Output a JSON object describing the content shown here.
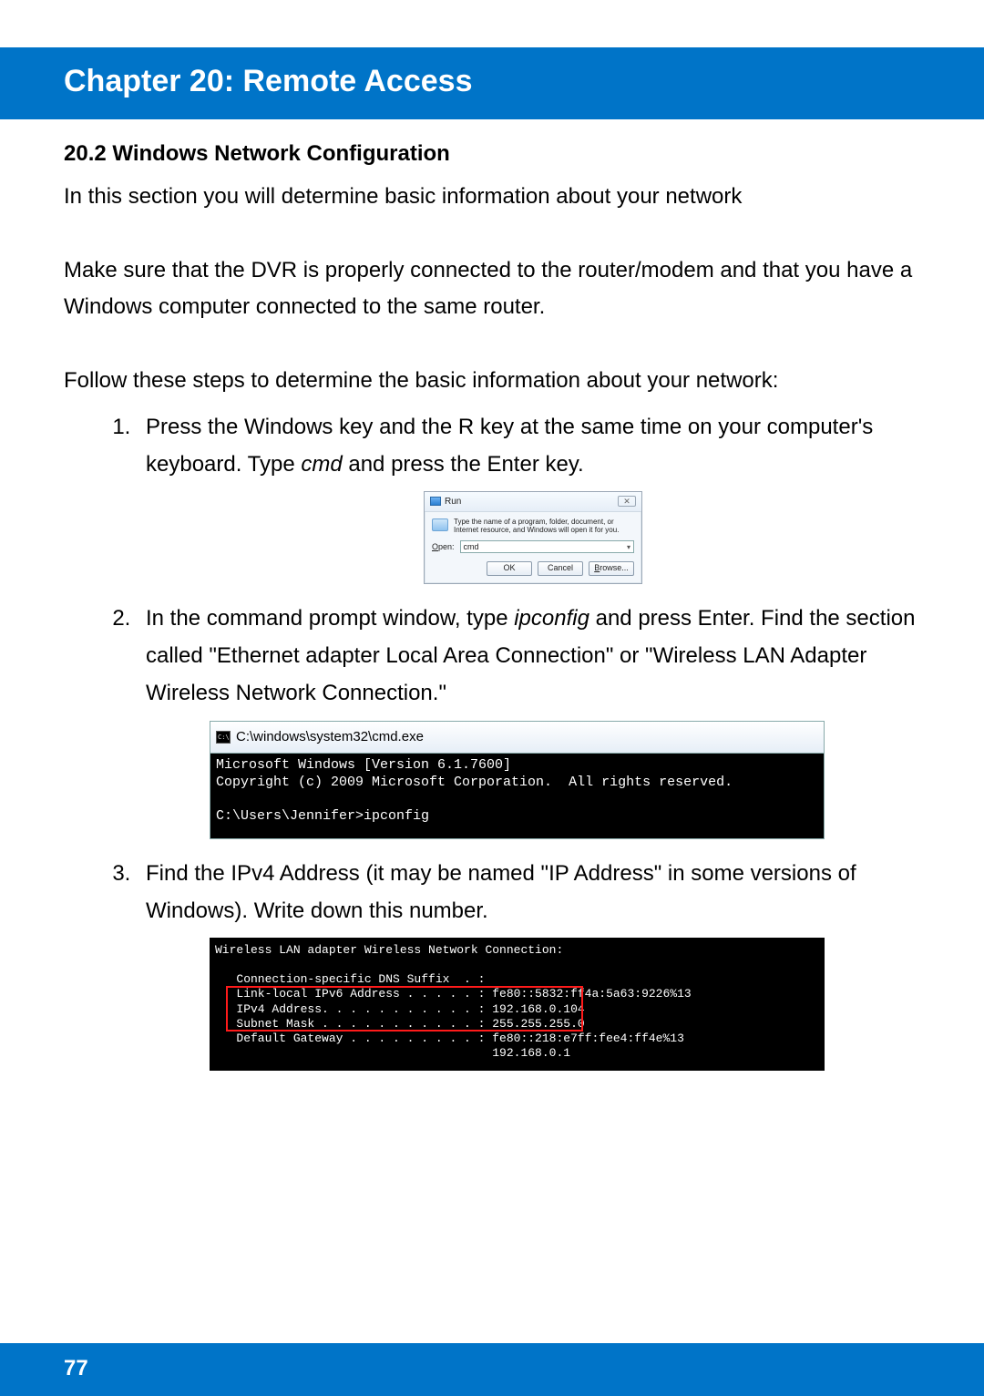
{
  "chapter": {
    "title": "Chapter 20: Remote Access"
  },
  "section": {
    "number_title": "20.2 Windows Network Configuration"
  },
  "paras": {
    "intro": "In this section you will determine basic information about your network",
    "prereq": "Make sure that the DVR is properly connected to the router/modem and that you have a Windows computer connected to the same router.",
    "follow": "Follow these steps to determine the basic information about your network:"
  },
  "steps": {
    "s1a": "Press the Windows key and the R key at the same time on your computer's keyboard. Type ",
    "s1_cmd": "cmd",
    "s1b": " and press the Enter key.",
    "s2a": "In the command prompt window, type ",
    "s2_cmd": "ipconfig",
    "s2b": " and press Enter. Find the section called \"Ethernet adapter Local Area Connection\" or \"Wireless LAN Adapter Wireless Network Connection.\"",
    "s3": "Find the IPv4 Address (it may be named \"IP Address\" in some versions of Windows). Write down this number."
  },
  "run_dialog": {
    "title": "Run",
    "desc": "Type the name of a program, folder, document, or Internet resource, and Windows will open it for you.",
    "open_label": "Open:",
    "value": "cmd",
    "ok": "OK",
    "cancel": "Cancel",
    "browse": "Browse..."
  },
  "cmd1": {
    "title": "C:\\windows\\system32\\cmd.exe",
    "line1": "Microsoft Windows [Version 6.1.7600]",
    "line2": "Copyright (c) 2009 Microsoft Corporation.  All rights reserved.",
    "line3": "",
    "line4": "C:\\Users\\Jennifer>ipconfig"
  },
  "cmd2": {
    "l1": "Wireless LAN adapter Wireless Network Connection:",
    "l2": "",
    "l3": "   Connection-specific DNS Suffix  . :",
    "l4": "   Link-local IPv6 Address . . . . . : fe80::5832:ff4a:5a63:9226%13",
    "l5": "   IPv4 Address. . . . . . . . . . . : 192.168.0.104",
    "l6": "   Subnet Mask . . . . . . . . . . . : 255.255.255.0",
    "l7": "   Default Gateway . . . . . . . . . : fe80::218:e7ff:fee4:ff4e%13",
    "l8": "                                       192.168.0.1"
  },
  "footer": {
    "page": "77"
  }
}
